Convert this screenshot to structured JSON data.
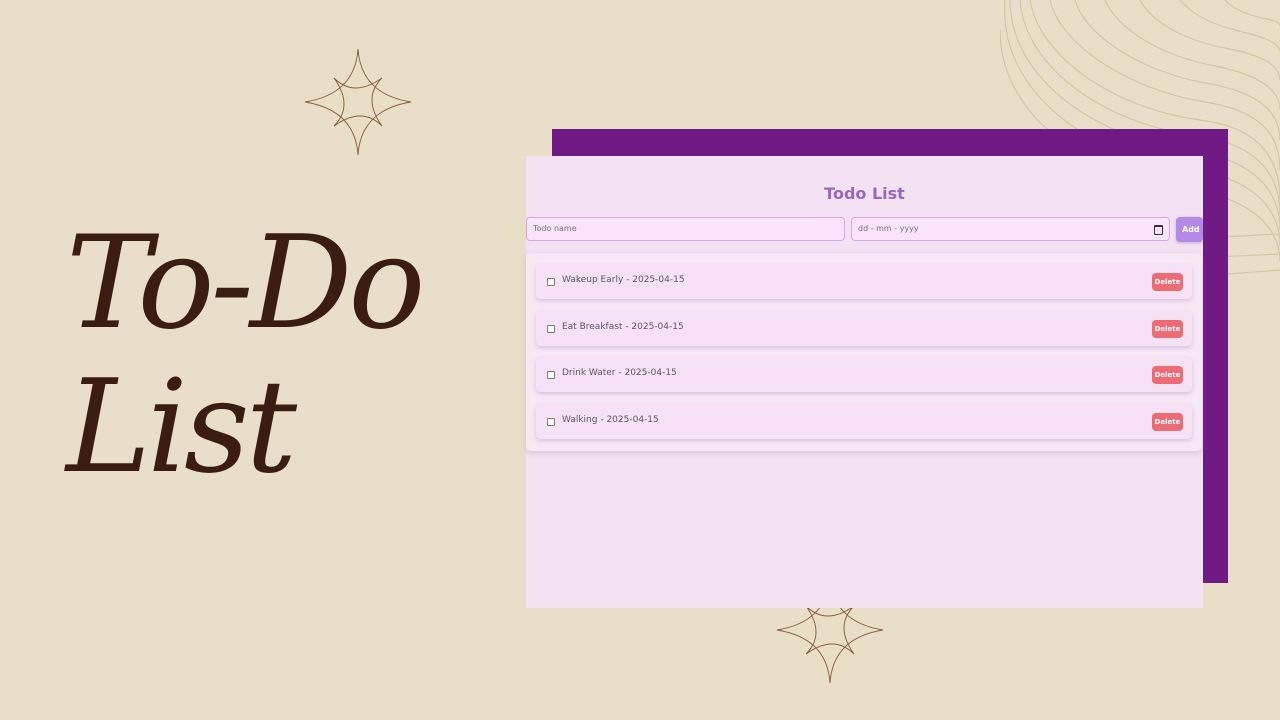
{
  "slide": {
    "title_line1": "To-Do",
    "title_line2": "List",
    "background_color": "#e9dec8",
    "title_color": "#3a1d10"
  },
  "app": {
    "title": "Todo List",
    "todo_input_placeholder": "Todo name",
    "date_input_placeholder": "dd - mm - yyyy",
    "add_label": "Add",
    "accent_color": "#b489e8",
    "shadow_panel_color": "#701a86",
    "items": [
      {
        "text": "Wakeup Early - 2025-04-15",
        "delete_label": "Delete"
      },
      {
        "text": "Eat Breakfast - 2025-04-15",
        "delete_label": "Delete"
      },
      {
        "text": "Drink Water - 2025-04-15",
        "delete_label": "Delete"
      },
      {
        "text": "Walking - 2025-04-15",
        "delete_label": "Delete"
      }
    ]
  },
  "icons": [
    "sparkle-icon",
    "calendar-icon",
    "contour-lines-decoration"
  ]
}
